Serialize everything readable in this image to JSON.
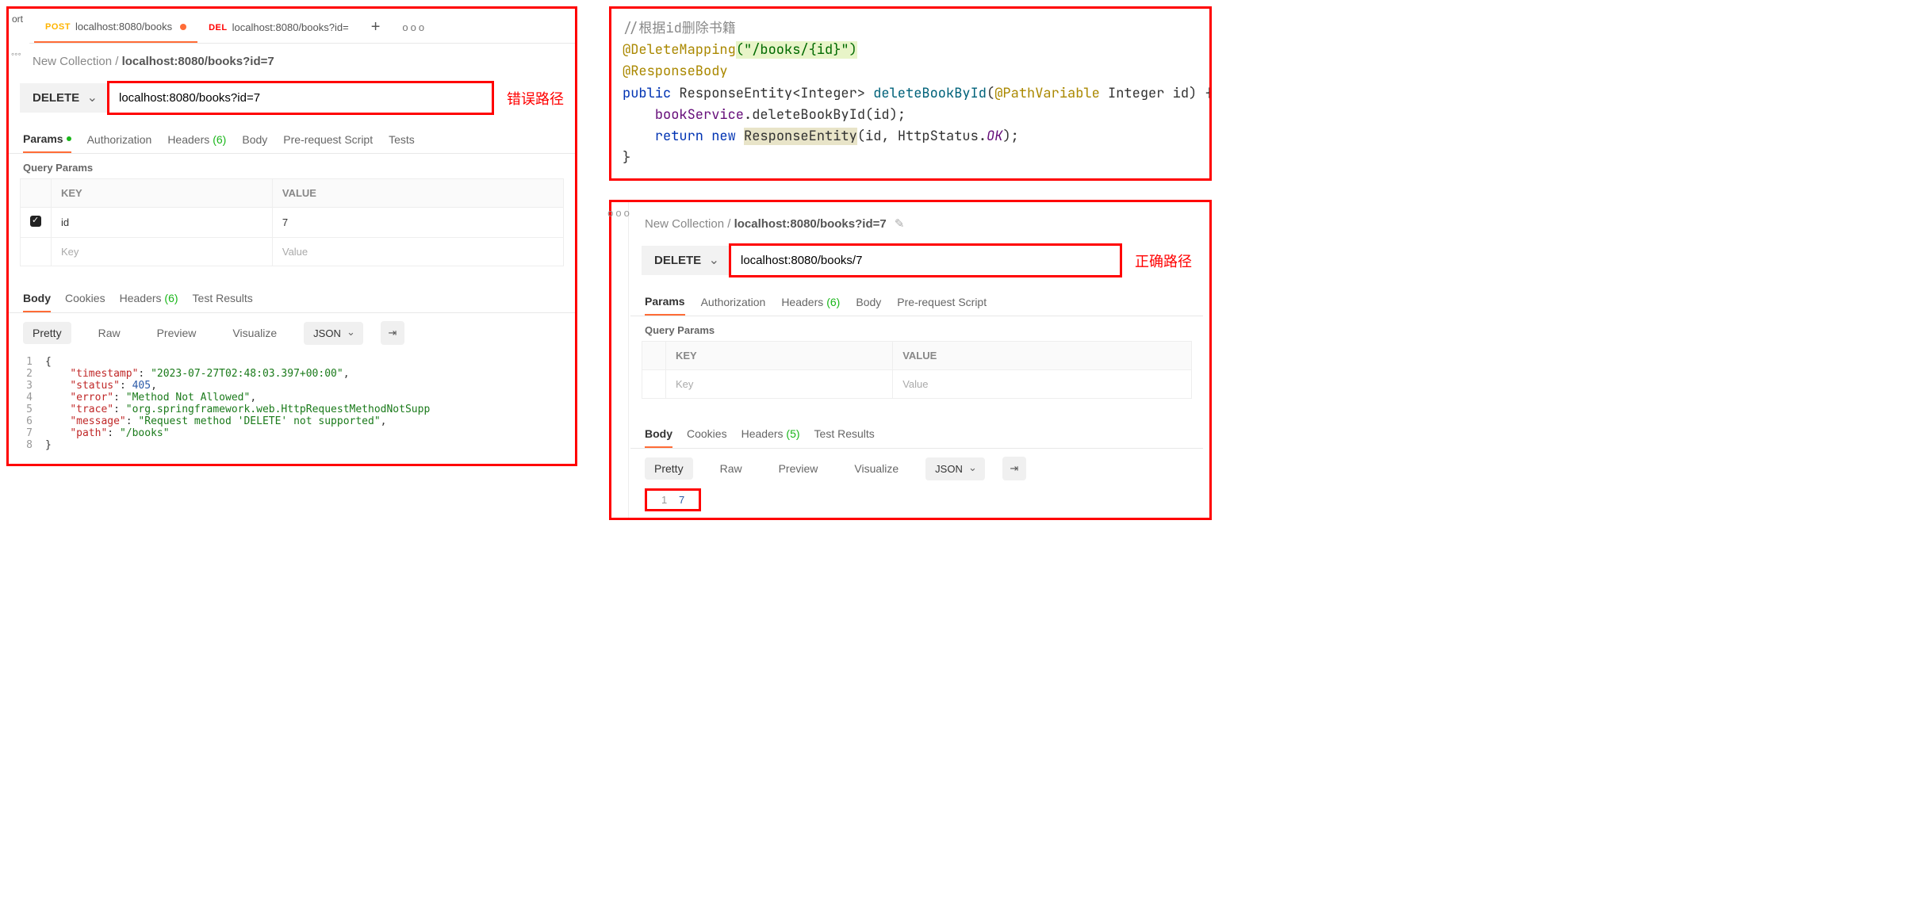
{
  "leftPanel": {
    "sideBtn1": "ort",
    "sideBtn2": "◦◦◦",
    "tabs": [
      {
        "method": "POST",
        "title": "localhost:8080/books",
        "unsaved": true,
        "active": true,
        "methodClass": "tab-method-post"
      },
      {
        "method": "DEL",
        "title": "localhost:8080/books?id=",
        "unsaved": false,
        "active": false,
        "methodClass": "tab-method-del"
      }
    ],
    "crumbCollection": "New Collection",
    "crumbSep": " / ",
    "crumbCurrent": "localhost:8080/books?id=7",
    "method": "DELETE",
    "url": "localhost:8080/books?id=7",
    "urlAnnot": "错误路径",
    "reqTabs": {
      "params": "Params",
      "auth": "Authorization",
      "headers": "Headers",
      "headersCount": "(6)",
      "body": "Body",
      "prs": "Pre-request Script",
      "tests": "Tests"
    },
    "queryParamsTitle": "Query Params",
    "qpHeaders": {
      "key": "KEY",
      "value": "VALUE"
    },
    "qpRow": {
      "key": "id",
      "value": "7"
    },
    "qpPh": {
      "key": "Key",
      "value": "Value"
    },
    "respTabs": {
      "body": "Body",
      "cookies": "Cookies",
      "headers": "Headers",
      "headersCount": "(6)",
      "test": "Test Results"
    },
    "viewBtns": {
      "pretty": "Pretty",
      "raw": "Raw",
      "preview": "Preview",
      "visualize": "Visualize",
      "fmt": "JSON"
    },
    "respCode": [
      {
        "n": "1",
        "t": "{"
      },
      {
        "n": "2",
        "k": "\"timestamp\"",
        "v": "\"2023-07-27T02:48:03.397+00:00\"",
        "vc": "cs",
        "comma": true
      },
      {
        "n": "3",
        "k": "\"status\"",
        "v": "405",
        "vc": "cn",
        "comma": true
      },
      {
        "n": "4",
        "k": "\"error\"",
        "v": "\"Method Not Allowed\"",
        "vc": "cs",
        "comma": true
      },
      {
        "n": "5",
        "k": "\"trace\"",
        "v": "\"org.springframework.web.HttpRequestMethodNotSupp",
        "vc": "cs"
      },
      {
        "n": "6",
        "k": "\"message\"",
        "v": "\"Request method 'DELETE' not supported\"",
        "vc": "cs",
        "comma": true
      },
      {
        "n": "7",
        "k": "\"path\"",
        "v": "\"/books\"",
        "vc": "cs"
      },
      {
        "n": "8",
        "t": "}"
      }
    ]
  },
  "codePanel": {
    "l1_cmt": "//根据id删除书籍",
    "l2_ann": "@DeleteMapping",
    "l2_arg": "(\"/books/{id}\")",
    "l3_ann": "@ResponseBody",
    "l4_kw": "public",
    "l4_ret": " ResponseEntity<Integer> ",
    "l4_fn": "deleteBookById",
    "l4_open": "(",
    "l4_pv": "@PathVariable",
    "l4_rest": " Integer id) {",
    "l5_indent": "    ",
    "l5_obj": "bookService",
    "l5_call": ".deleteBookById(id);",
    "l6_indent": "    ",
    "l6_ret": "return new ",
    "l6_re": "ResponseEntity",
    "l6_rest": "(id, HttpStatus.",
    "l6_ok": "OK",
    "l6_end": ");",
    "l7": "}"
  },
  "rightPanel": {
    "crumbCollection": "New Collection",
    "crumbSep": " / ",
    "crumbCurrent": "localhost:8080/books?id=7",
    "method": "DELETE",
    "url": "localhost:8080/books/7",
    "urlAnnot": "正确路径",
    "reqTabs": {
      "params": "Params",
      "auth": "Authorization",
      "headers": "Headers",
      "headersCount": "(6)",
      "body": "Body",
      "prs": "Pre-request Script"
    },
    "queryParamsTitle": "Query Params",
    "qpHeaders": {
      "key": "KEY",
      "value": "VALUE"
    },
    "qpPh": {
      "key": "Key",
      "value": "Value"
    },
    "respTabs": {
      "body": "Body",
      "cookies": "Cookies",
      "headers": "Headers",
      "headersCount": "(5)",
      "test": "Test Results"
    },
    "viewBtns": {
      "pretty": "Pretty",
      "raw": "Raw",
      "preview": "Preview",
      "visualize": "Visualize",
      "fmt": "JSON"
    },
    "sevenLine": {
      "n": "1",
      "v": "7"
    }
  }
}
